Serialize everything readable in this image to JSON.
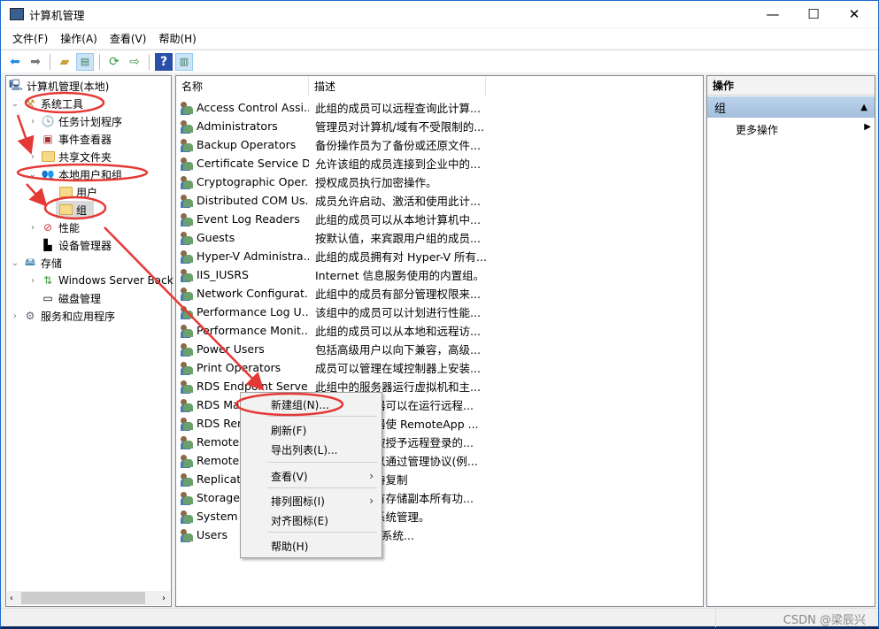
{
  "window": {
    "title": "计算机管理",
    "controls": [
      "minimize",
      "maximize",
      "close"
    ]
  },
  "menubar": [
    "文件(F)",
    "操作(A)",
    "查看(V)",
    "帮助(H)"
  ],
  "toolbar": [
    "back-icon",
    "forward-icon",
    "up-folder-icon",
    "show-hide-tree-icon",
    "refresh-icon",
    "export-list-icon",
    "help-icon",
    "show-hide-action-icon"
  ],
  "tree": {
    "root": "计算机管理(本地)",
    "items": [
      "系统工具",
      "任务计划程序",
      "事件查看器",
      "共享文件夹",
      "本地用户和组",
      "用户",
      "组",
      "性能",
      "设备管理器",
      "存储",
      "Windows Server Back",
      "磁盘管理",
      "服务和应用程序"
    ]
  },
  "list": {
    "columns": [
      "名称",
      "描述"
    ],
    "rows": [
      [
        "Access Control Assi...",
        "此组的成员可以远程查询此计算..."
      ],
      [
        "Administrators",
        "管理员对计算机/域有不受限制的..."
      ],
      [
        "Backup Operators",
        "备份操作员为了备份或还原文件..."
      ],
      [
        "Certificate Service D...",
        "允许该组的成员连接到企业中的..."
      ],
      [
        "Cryptographic Oper...",
        "授权成员执行加密操作。"
      ],
      [
        "Distributed COM Us...",
        "成员允许启动、激活和使用此计..."
      ],
      [
        "Event Log Readers",
        "此组的成员可以从本地计算机中..."
      ],
      [
        "Guests",
        "按默认值，来宾跟用户组的成员..."
      ],
      [
        "Hyper-V Administra...",
        "此组的成员拥有对 Hyper-V 所有..."
      ],
      [
        "IIS_IUSRS",
        "Internet 信息服务使用的内置组。"
      ],
      [
        "Network Configurat...",
        "此组中的成员有部分管理权限来..."
      ],
      [
        "Performance Log U...",
        "该组中的成员可以计划进行性能..."
      ],
      [
        "Performance Monit...",
        "此组的成员可以从本地和远程访..."
      ],
      [
        "Power Users",
        "包括高级用户以向下兼容，高级..."
      ],
      [
        "Print Operators",
        "成员可以管理在域控制器上安装..."
      ],
      [
        "RDS Endpoint Serve...",
        "此组中的服务器运行虚拟机和主..."
      ],
      [
        "RDS Mar",
        "器可以在运行远程..."
      ],
      [
        "RDS Rem",
        "器使 RemoteApp ..."
      ],
      [
        "Remote I",
        "被授予远程登录的..."
      ],
      [
        "Remote I",
        "以通过管理协议(例..."
      ],
      [
        "Replicato",
        "持复制"
      ],
      [
        "Storage",
        "有存储副本所有功..."
      ],
      [
        "System M",
        "系统管理。"
      ],
      [
        "Users",
        "有意或无意的系统..."
      ]
    ]
  },
  "actions": {
    "header": "操作",
    "group": "组",
    "more": "更多操作"
  },
  "context_menu": {
    "items": [
      "新建组(N)...",
      "刷新(F)",
      "导出列表(L)...",
      "查看(V)",
      "排列图标(I)",
      "对齐图标(E)",
      "帮助(H)"
    ]
  },
  "status": {
    "watermark": "CSDN @梁辰兴"
  },
  "colors": {
    "annotation": "#e53935",
    "selection": "#d9d9d9",
    "action_group": "#a9c4e0"
  }
}
